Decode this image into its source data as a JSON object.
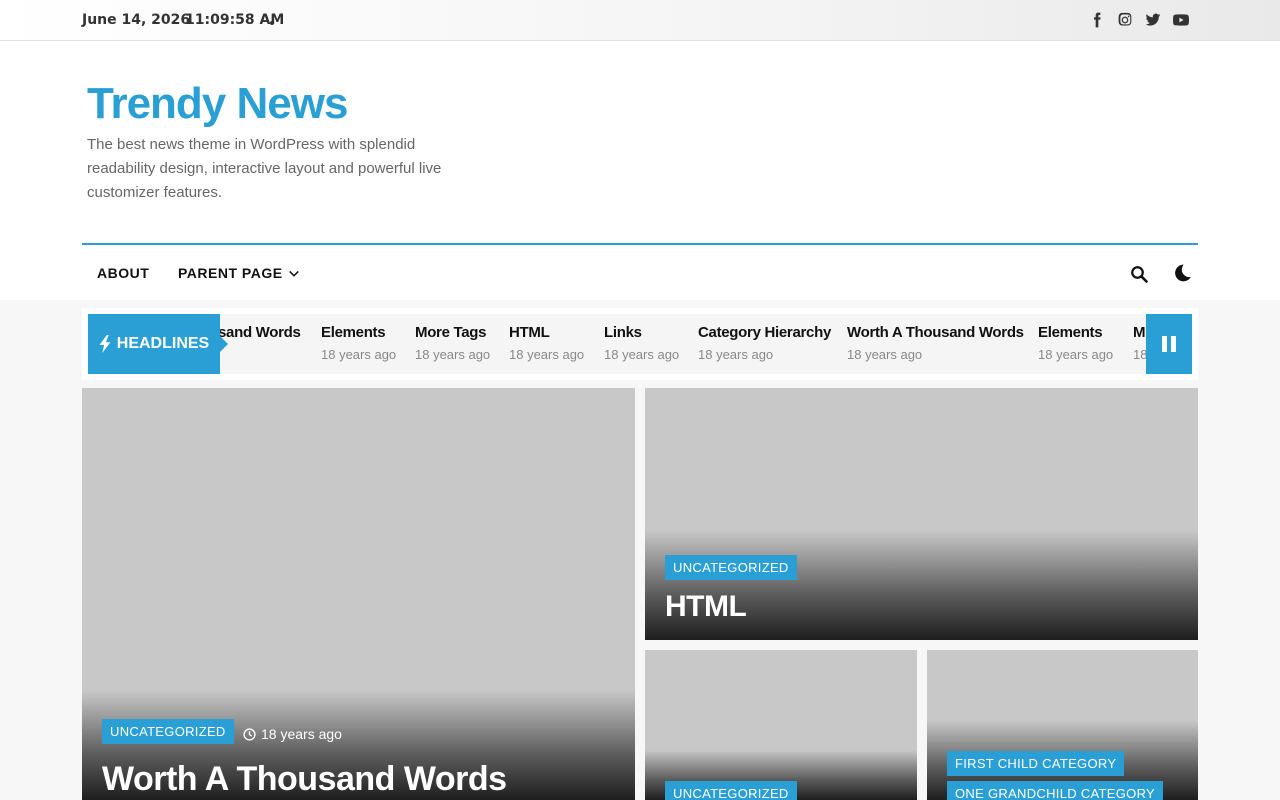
{
  "topbar": {
    "date": "June 14, 2026",
    "time": "11:09:58 AM",
    "social_icons": [
      "facebook-icon",
      "instagram-icon",
      "twitter-icon",
      "youtube-icon"
    ]
  },
  "site": {
    "title": "Trendy News",
    "description": "The best news theme in WordPress with splendid readability design, interactive layout and powerful live customizer features."
  },
  "nav": {
    "about": "ABOUT",
    "parent": "PARENT PAGE"
  },
  "ticker": {
    "label": "HEADLINES",
    "items": [
      {
        "title": "sand Words",
        "ago": ""
      },
      {
        "title": "Elements",
        "ago": "18 years ago"
      },
      {
        "title": "More Tags",
        "ago": "18 years ago"
      },
      {
        "title": "HTML",
        "ago": "18 years ago"
      },
      {
        "title": "Links",
        "ago": "18 years ago"
      },
      {
        "title": "Category Hierarchy",
        "ago": "18 years ago"
      },
      {
        "title": "Worth A Thousand Words",
        "ago": "18 years ago"
      },
      {
        "title": "Elements",
        "ago": "18 years ago"
      },
      {
        "title": "M",
        "ago": "18"
      }
    ]
  },
  "posts": {
    "main": {
      "category": "UNCATEGORIZED",
      "ago": "18 years ago",
      "title": "Worth A Thousand Words"
    },
    "top_right": {
      "category": "UNCATEGORIZED",
      "title": "HTML"
    },
    "bottom_left": {
      "category": "UNCATEGORIZED"
    },
    "bottom_right": {
      "category_1": "FIRST CHILD CATEGORY",
      "category_2": "ONE GRANDCHILD CATEGORY"
    }
  },
  "colors": {
    "accent": "#2a9fd6"
  }
}
